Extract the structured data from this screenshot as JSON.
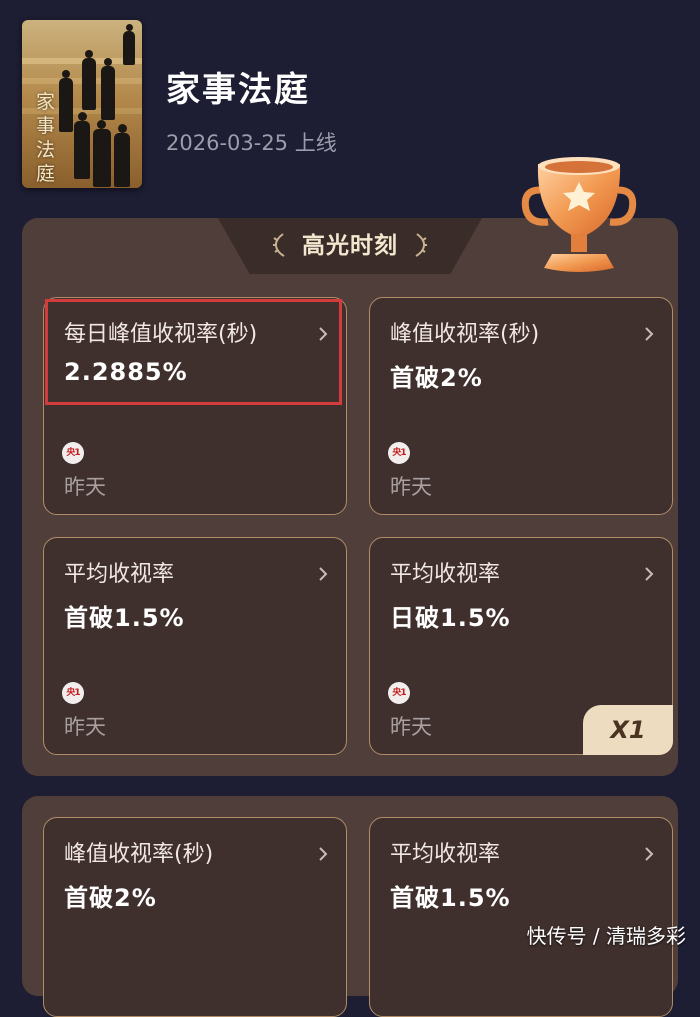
{
  "header": {
    "poster_text": "家事法庭",
    "title": "家事法庭",
    "release": "2026-03-25 上线"
  },
  "highlights": {
    "section_title": "高光时刻",
    "cards": [
      {
        "label": "每日峰值收视率(秒)",
        "value": "2.2885%",
        "channel": "央1",
        "date": "昨天",
        "highlighted": true
      },
      {
        "label": "峰值收视率(秒)",
        "value": "首破2%",
        "channel": "央1",
        "date": "昨天"
      },
      {
        "label": "平均收视率",
        "value": "首破1.5%",
        "channel": "央1",
        "date": "昨天"
      },
      {
        "label": "平均收视率",
        "value": "日破1.5%",
        "channel": "央1",
        "date": "昨天",
        "badge": "X1"
      }
    ]
  },
  "second_section": {
    "cards": [
      {
        "label": "峰值收视率(秒)",
        "value": "首破2%"
      },
      {
        "label": "平均收视率",
        "value": "首破1.5%"
      }
    ]
  },
  "watermark": "快传号 / 清瑞多彩",
  "colors": {
    "background": "#1d1d33",
    "panel": "#4f3e3a",
    "card": "#3f2f2d",
    "card_border": "#b08d68",
    "highlight_box": "#d33c3c",
    "badge": "#eedcc0"
  },
  "icons": {
    "trophy": "trophy-icon",
    "chevron": "chevron-right-icon",
    "channel": "cctv1-logo-icon"
  }
}
